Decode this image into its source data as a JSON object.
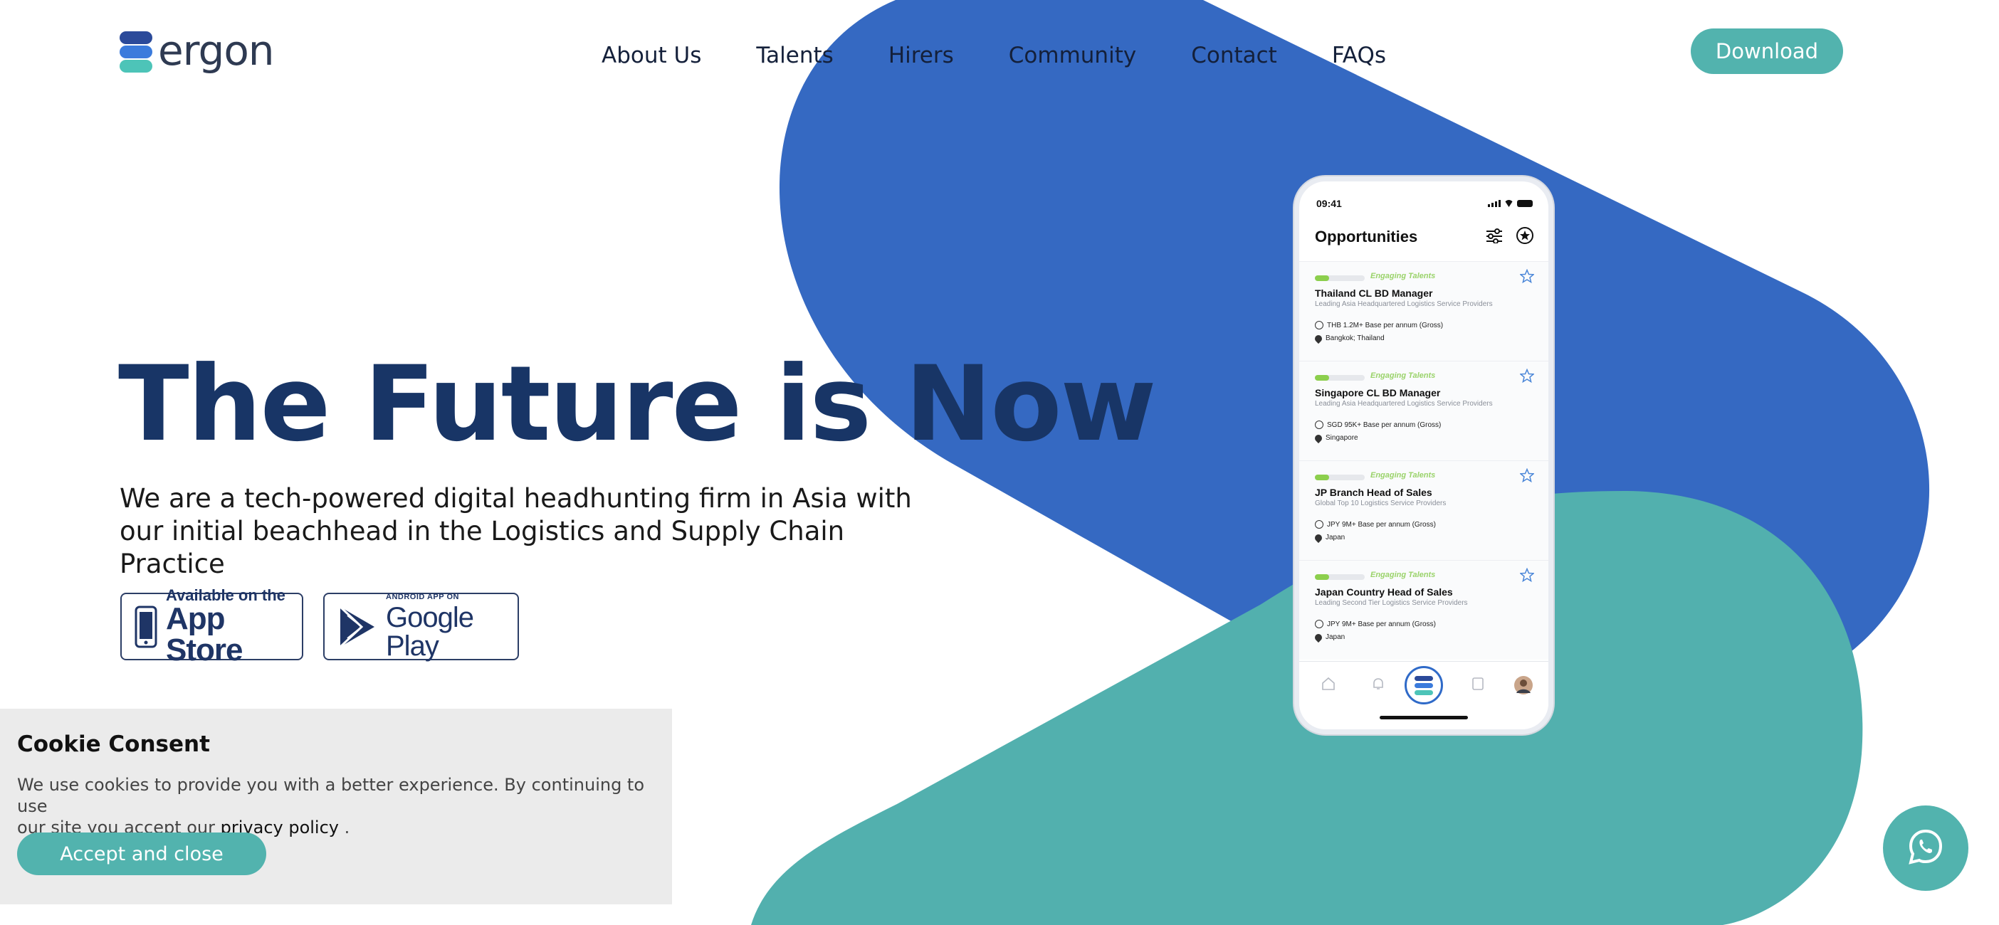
{
  "brand": {
    "name": "ergon"
  },
  "nav": [
    "About Us",
    "Talents",
    "Hirers",
    "Community",
    "Contact",
    "FAQs"
  ],
  "header": {
    "download_label": "Download"
  },
  "hero": {
    "title": "The Future is Now",
    "subtitle_line1": "We are a tech-powered digital headhunting firm in Asia with",
    "subtitle_line2": "our initial beachhead in the Logistics and Supply Chain Practice"
  },
  "stores": {
    "app_small": "Available on the",
    "app_big": "App Store",
    "gp_small": "ANDROID APP ON",
    "gp_big": "Google Play"
  },
  "phone": {
    "time": "09:41",
    "title": "Opportunities",
    "jobs": [
      {
        "status": "Engaging Talents",
        "title": "Thailand CL BD Manager",
        "company": "Leading Asia Headquartered Logistics Service Providers",
        "salary": "THB 1.2M+ Base per annum (Gross)",
        "location": "Bangkok; Thailand"
      },
      {
        "status": "Engaging Talents",
        "title": "Singapore CL BD Manager",
        "company": "Leading Asia Headquartered Logistics Service Providers",
        "salary": "SGD 95K+ Base per annum (Gross)",
        "location": "Singapore"
      },
      {
        "status": "Engaging Talents",
        "title": "JP Branch Head of Sales",
        "company": "Global Top 10 Logistics Service Providers",
        "salary": "JPY 9M+ Base per annum (Gross)",
        "location": "Japan"
      },
      {
        "status": "Engaging Talents",
        "title": "Japan Country Head of Sales",
        "company": "Leading Second Tier Logistics Service Providers",
        "salary": "JPY 9M+ Base per annum (Gross)",
        "location": "Japan"
      }
    ]
  },
  "cookie": {
    "title": "Cookie Consent",
    "text_line1": "We use cookies to provide you with a better experience. By continuing to use",
    "text_line2_pre": "our site you accept our",
    "link": "privacy policy",
    "text_line2_post": " .",
    "accept_label": "Accept and close"
  },
  "colors": {
    "blue": "#3569c2",
    "teal": "#52b0ae",
    "navy": "#183566"
  },
  "icons": [
    "whatsapp-icon",
    "apple-phone-icon",
    "google-play-icon",
    "filter-icon",
    "star-icon",
    "home-icon",
    "bell-icon",
    "ergon-tab-icon",
    "document-icon",
    "profile-avatar"
  ]
}
